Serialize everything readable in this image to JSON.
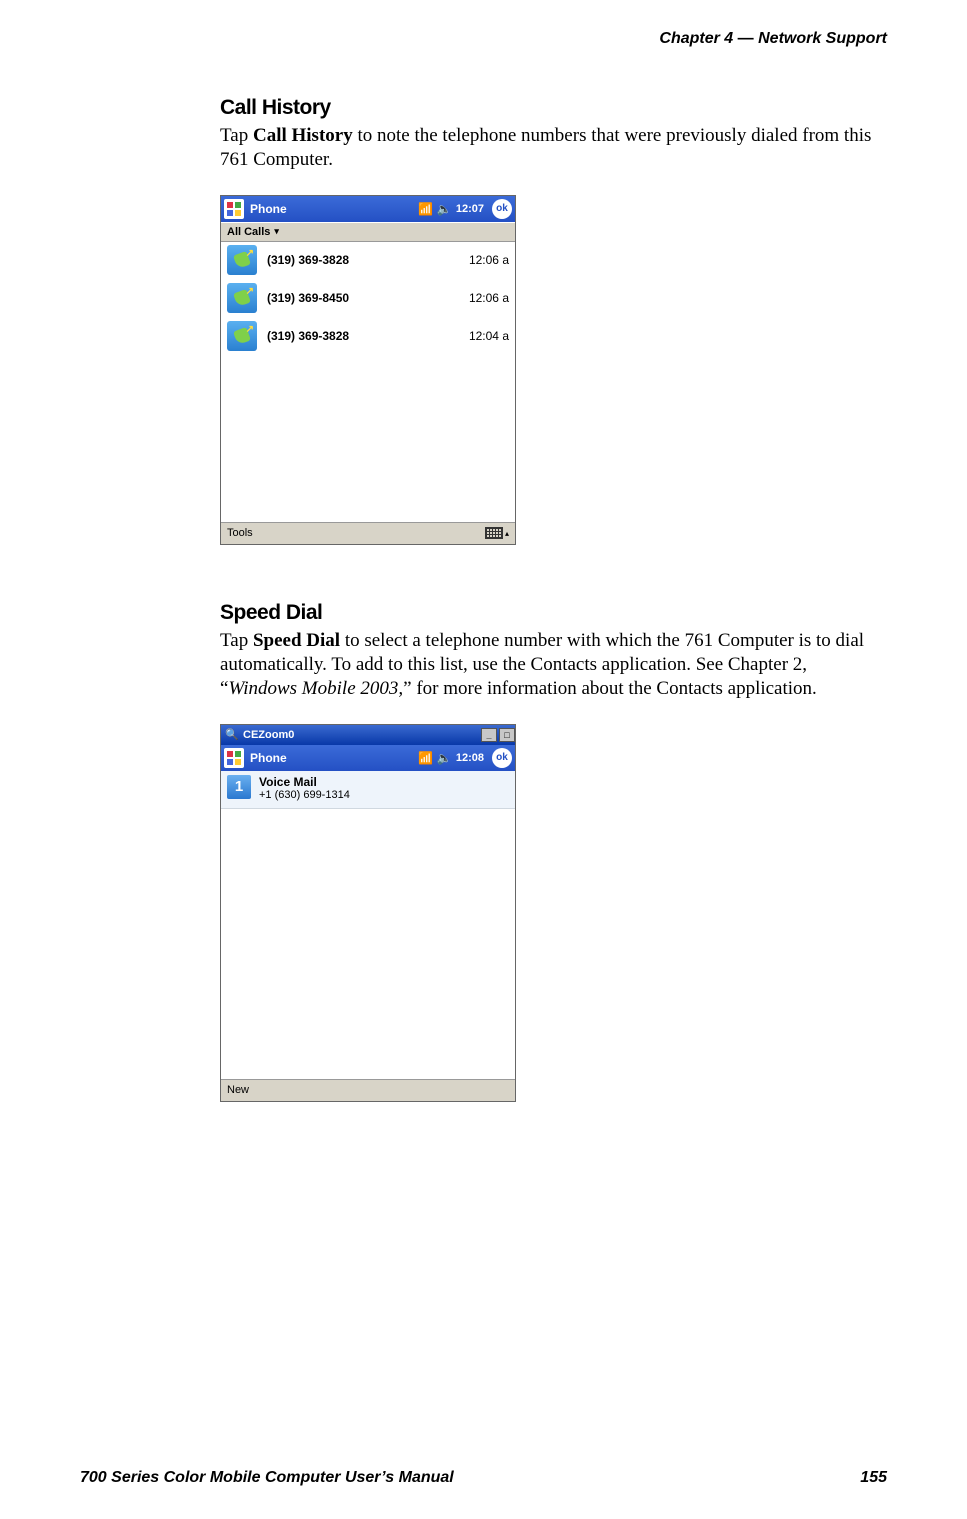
{
  "header": {
    "chapter_label": "Chapter",
    "chapter_num": "4",
    "dash": "—",
    "section_name": "Network Support"
  },
  "sections": {
    "call_history": {
      "title": "Call History",
      "para_pre": "Tap ",
      "para_bold": "Call History",
      "para_post": " to note the telephone numbers that were previously dialed from this 761 Computer."
    },
    "speed_dial": {
      "title": "Speed Dial",
      "para_pre": "Tap ",
      "para_bold": "Speed Dial",
      "para_mid": " to select a telephone number with which the 761 Com­puter is to dial automatically. To add to this list, use the Contacts applica­tion. See Chapter 2, “",
      "para_italic": "Windows Mobile 2003,",
      "para_post": "” for more information about the Contacts application."
    }
  },
  "screenshot1": {
    "status": {
      "title": "Phone",
      "time": "12:07",
      "ok": "ok"
    },
    "filter": "All Calls",
    "calls": [
      {
        "number": "(319) 369-3828",
        "time": "12:06 a"
      },
      {
        "number": "(319) 369-8450",
        "time": "12:06 a"
      },
      {
        "number": "(319) 369-3828",
        "time": "12:04 a"
      }
    ],
    "tools": "Tools"
  },
  "screenshot2": {
    "window_title": "CEZoom0",
    "status": {
      "title": "Phone",
      "time": "12:08",
      "ok": "ok"
    },
    "entries": [
      {
        "slot": "1",
        "name": "Voice Mail",
        "number": "+1 (630) 699-1314"
      }
    ],
    "new": "New"
  },
  "footer": {
    "left": "700 Series Color Mobile Computer User’s Manual",
    "right": "155"
  }
}
